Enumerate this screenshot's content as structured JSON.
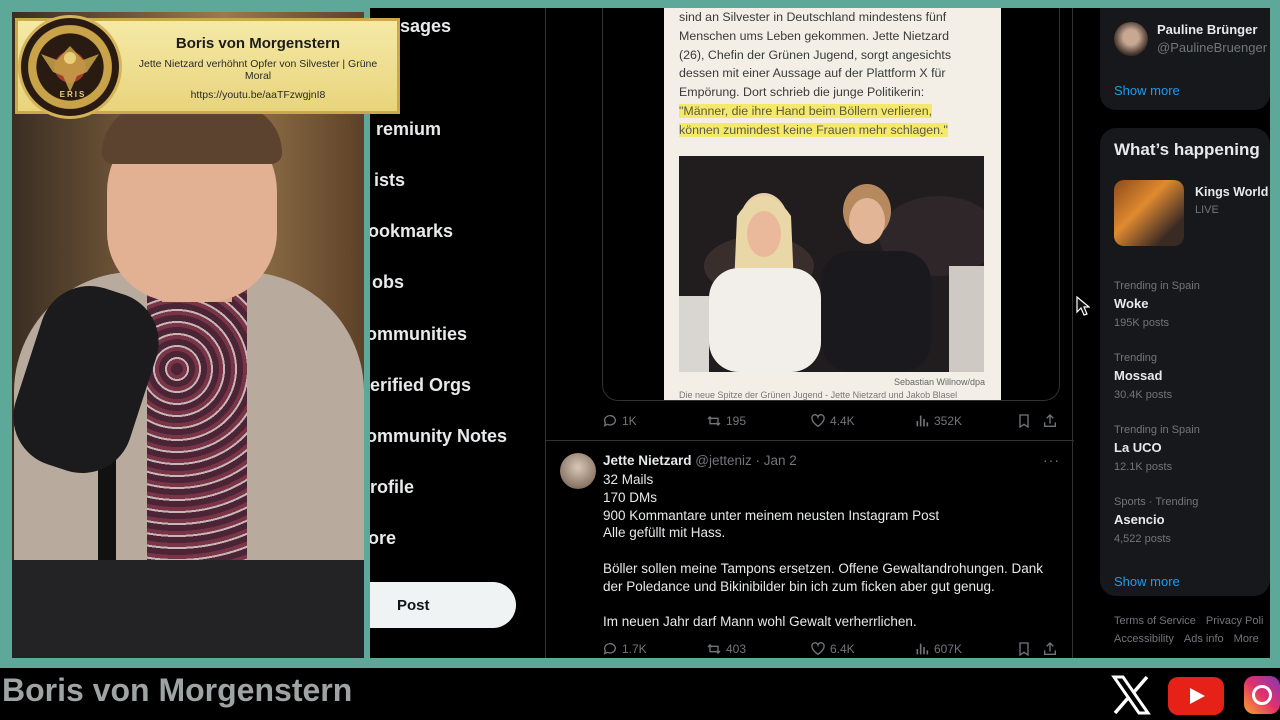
{
  "nav": {
    "items": [
      {
        "label": "Messages"
      },
      {
        "label": "Premium"
      },
      {
        "label": "Lists"
      },
      {
        "label": "Bookmarks"
      },
      {
        "label": "Jobs"
      },
      {
        "label": "Communities"
      },
      {
        "label": "Verified Orgs"
      },
      {
        "label": "Community Notes"
      },
      {
        "label": "Profile"
      },
      {
        "label": "More"
      }
    ],
    "visible_labels": [
      "ssages",
      "remium",
      "ists",
      "ookmarks",
      "obs",
      "ommunities",
      "erified Orgs",
      "ommunity Notes",
      "rofile",
      "ore"
    ],
    "post_label": "Post"
  },
  "tweet1": {
    "article_lines": [
      "sind an Silvester in Deutschland mindestens fünf",
      "Menschen ums Leben gekommen. Jette Nietzard",
      "(26), Chefin der Grünen Jugend, sorgt angesichts",
      "dessen mit einer Aussage auf der Plattform X für",
      "Empörung. Dort schrieb die junge Politikerin:"
    ],
    "quote_line1": "\"Männer, die ihre Hand beim Böllern verlieren,",
    "quote_line2": "können zumindest keine Frauen mehr schlagen.\"",
    "photo_credit": "Sebastian Willnow/dpa",
    "photo_caption": "Die neue Spitze der Grünen Jugend - Jette Nietzard und Jakob Blasel",
    "replies": "1K",
    "reposts": "195",
    "likes": "4.4K",
    "views": "352K"
  },
  "tweet2": {
    "name": "Jette Nietzard",
    "handle": "@jetteniz",
    "date": "· Jan 2",
    "more": "···",
    "lines": [
      "32 Mails",
      "170 DMs",
      "900 Kommantare unter meinem neusten Instagram Post",
      "Alle gefüllt mit Hass.",
      "",
      "Böller sollen meine Tampons ersetzen. Offene Gewaltandrohungen. Dank",
      "der Poledance und Bikinibilder bin ich zum ficken aber gut genug.",
      "",
      "Im neuen Jahr darf Mann wohl Gewalt verherrlichen."
    ],
    "replies": "1.7K",
    "reposts": "403",
    "likes": "6.4K",
    "views": "607K"
  },
  "right": {
    "follow": {
      "name": "Pauline Brünger",
      "handle": "@PaulineBruenger",
      "show_more": "Show more"
    },
    "whats_happening": "What’s happening",
    "live": {
      "title": "Kings World",
      "status": "LIVE"
    },
    "trends": [
      {
        "context": "Trending in Spain",
        "name": "Woke",
        "count": "195K posts"
      },
      {
        "context": "Trending",
        "name": "Mossad",
        "count": "30.4K posts"
      },
      {
        "context": "Trending in Spain",
        "name": "La UCO",
        "count": "12.1K posts"
      },
      {
        "context": "Sports · Trending",
        "name": "Asencio",
        "count": "4,522 posts"
      }
    ],
    "show_more": "Show more",
    "footer": [
      "Terms of Service",
      "Privacy Poli",
      "Accessibility",
      "Ads info",
      "More"
    ]
  },
  "overlay": {
    "title": "Boris von Morgenstern",
    "subtitle": "Jette Nietzard verhöhnt Opfer von Silvester | Grüne Moral",
    "url": "https://youtu.be/aaTFzwgjnI8",
    "seal_text": "ERIS"
  },
  "bottom": {
    "channel": "Boris von Morgenstern",
    "icons": [
      "x-logo-icon",
      "youtube-icon",
      "instagram-icon"
    ]
  },
  "colors": {
    "frame": "#5ea89a",
    "accent": "#1d9bf0",
    "highlight": "#f5e96a"
  }
}
